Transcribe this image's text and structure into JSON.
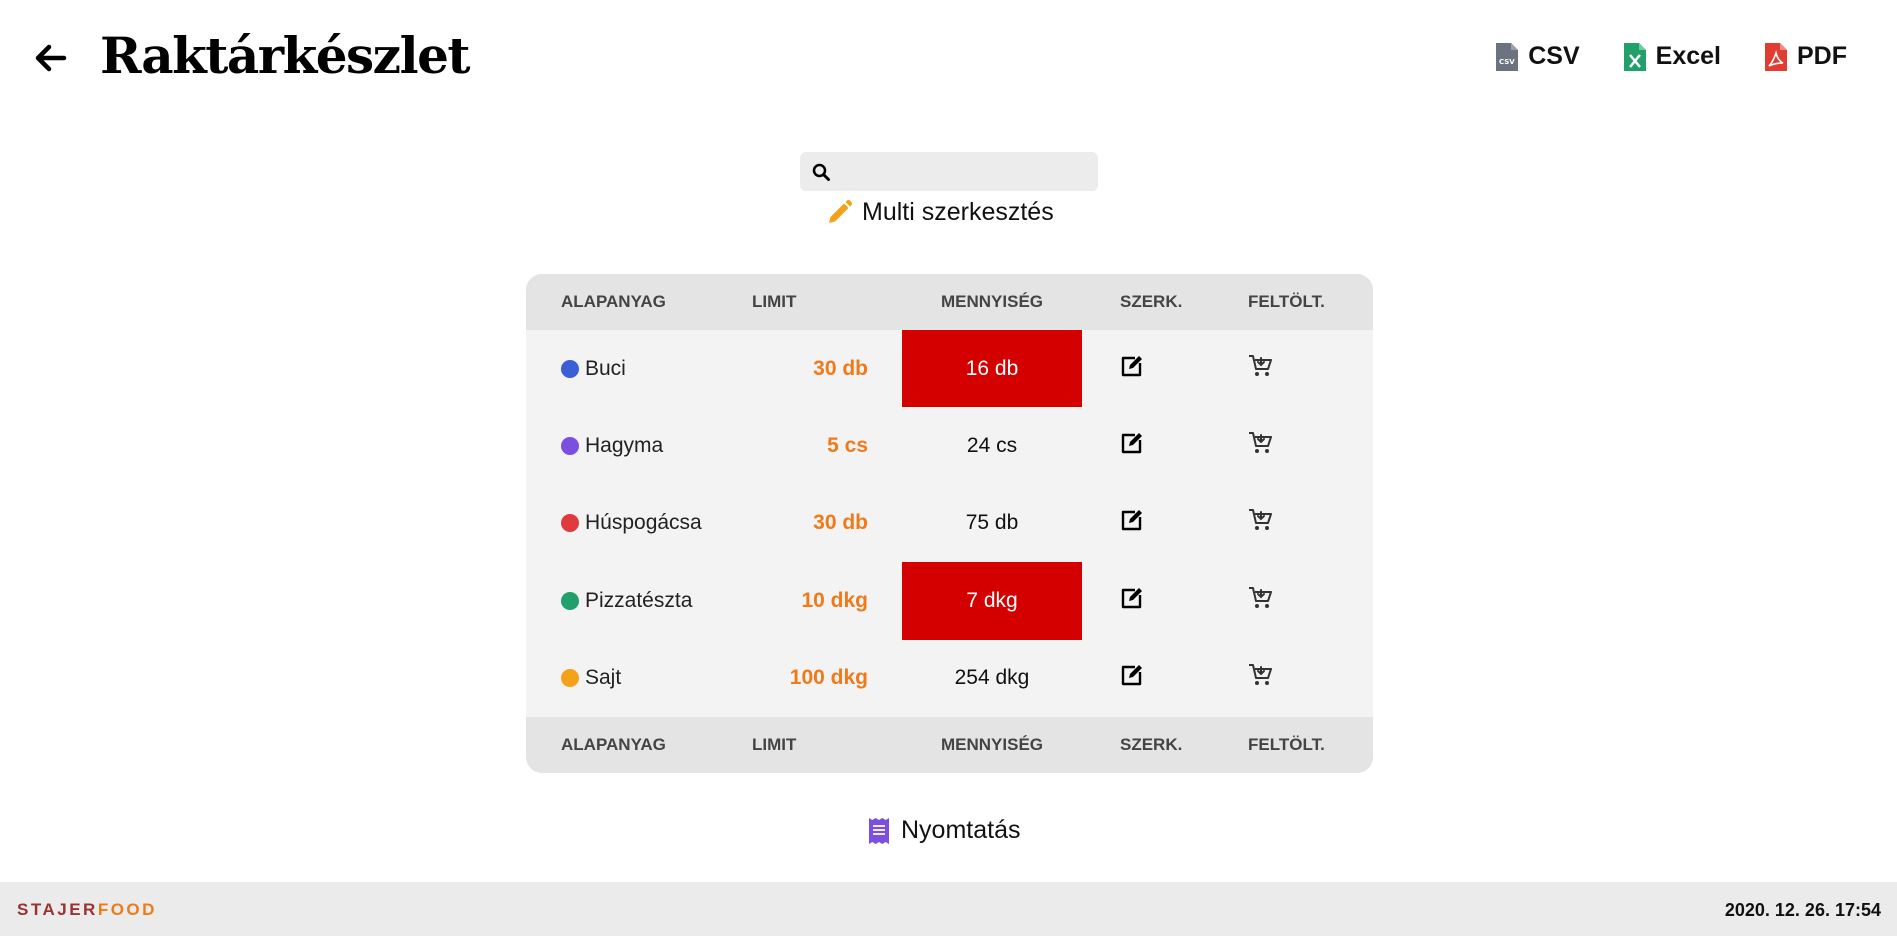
{
  "header": {
    "title": "Raktárkészlet",
    "exports": [
      {
        "label": "CSV",
        "icon": "csv-file-icon",
        "color": "#6b7280"
      },
      {
        "label": "Excel",
        "icon": "excel-file-icon",
        "color": "#22a06b"
      },
      {
        "label": "PDF",
        "icon": "pdf-file-icon",
        "color": "#e03c31"
      }
    ]
  },
  "search": {
    "value": "",
    "placeholder": ""
  },
  "multi_edit": {
    "label": "Multi szerkesztés",
    "icon_color": "#f5a11a"
  },
  "table": {
    "columns": [
      "ALAPANYAG",
      "LIMIT",
      "MENNYISÉG",
      "SZERK.",
      "FELTÖLT."
    ],
    "rows": [
      {
        "name": "Buci",
        "dot": "#3b5fd8",
        "limit": "30 db",
        "qty": "16 db",
        "low": true
      },
      {
        "name": "Hagyma",
        "dot": "#7b4fe0",
        "limit": "5 cs",
        "qty": "24 cs",
        "low": false
      },
      {
        "name": "Húspogácsa",
        "dot": "#e0393e",
        "limit": "30 db",
        "qty": "75 db",
        "low": false
      },
      {
        "name": "Pizzatészta",
        "dot": "#22a06b",
        "limit": "10 dkg",
        "qty": "7 dkg",
        "low": true
      },
      {
        "name": "Sajt",
        "dot": "#f5a11a",
        "limit": "100 dkg",
        "qty": "254 dkg",
        "low": false
      }
    ]
  },
  "print": {
    "label": "Nyomtatás",
    "icon_color": "#7b4fe0"
  },
  "footer": {
    "brand_part1": "STAJER",
    "brand_part2": "FOOD",
    "datetime": "2020. 12. 26. 17:54"
  }
}
